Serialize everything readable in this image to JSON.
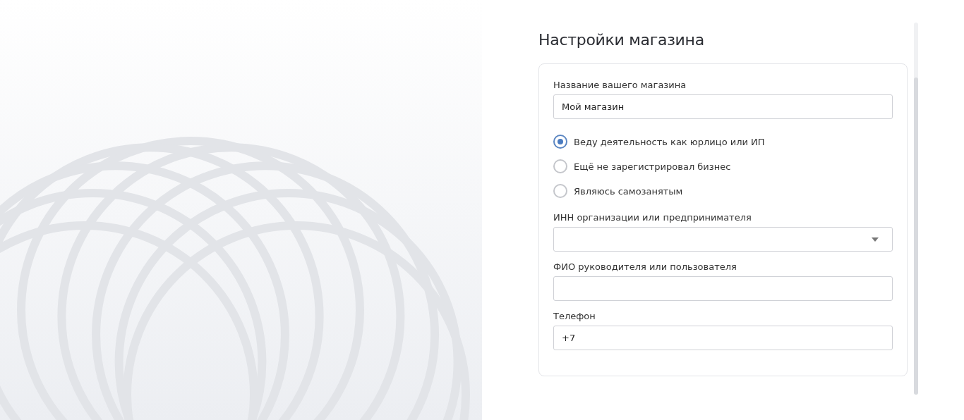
{
  "title": "Настройки магазина",
  "form": {
    "fields": [
      {
        "kind": "text",
        "label": "Название вашего магазина",
        "value": "Мой магазин"
      },
      {
        "kind": "radio",
        "options": [
          {
            "label": "Веду деятельность как юрлицо или ИП",
            "selected": true
          },
          {
            "label": "Ещё не зарегистрировал бизнес",
            "selected": false
          },
          {
            "label": "Являюсь самозанятым",
            "selected": false
          }
        ]
      },
      {
        "kind": "select",
        "label": "ИНН организации или предпринимателя"
      },
      {
        "kind": "text",
        "label": "ФИО руководителя или пользователя"
      },
      {
        "kind": "text",
        "label": "Телефон",
        "value": "+7"
      }
    ]
  }
}
